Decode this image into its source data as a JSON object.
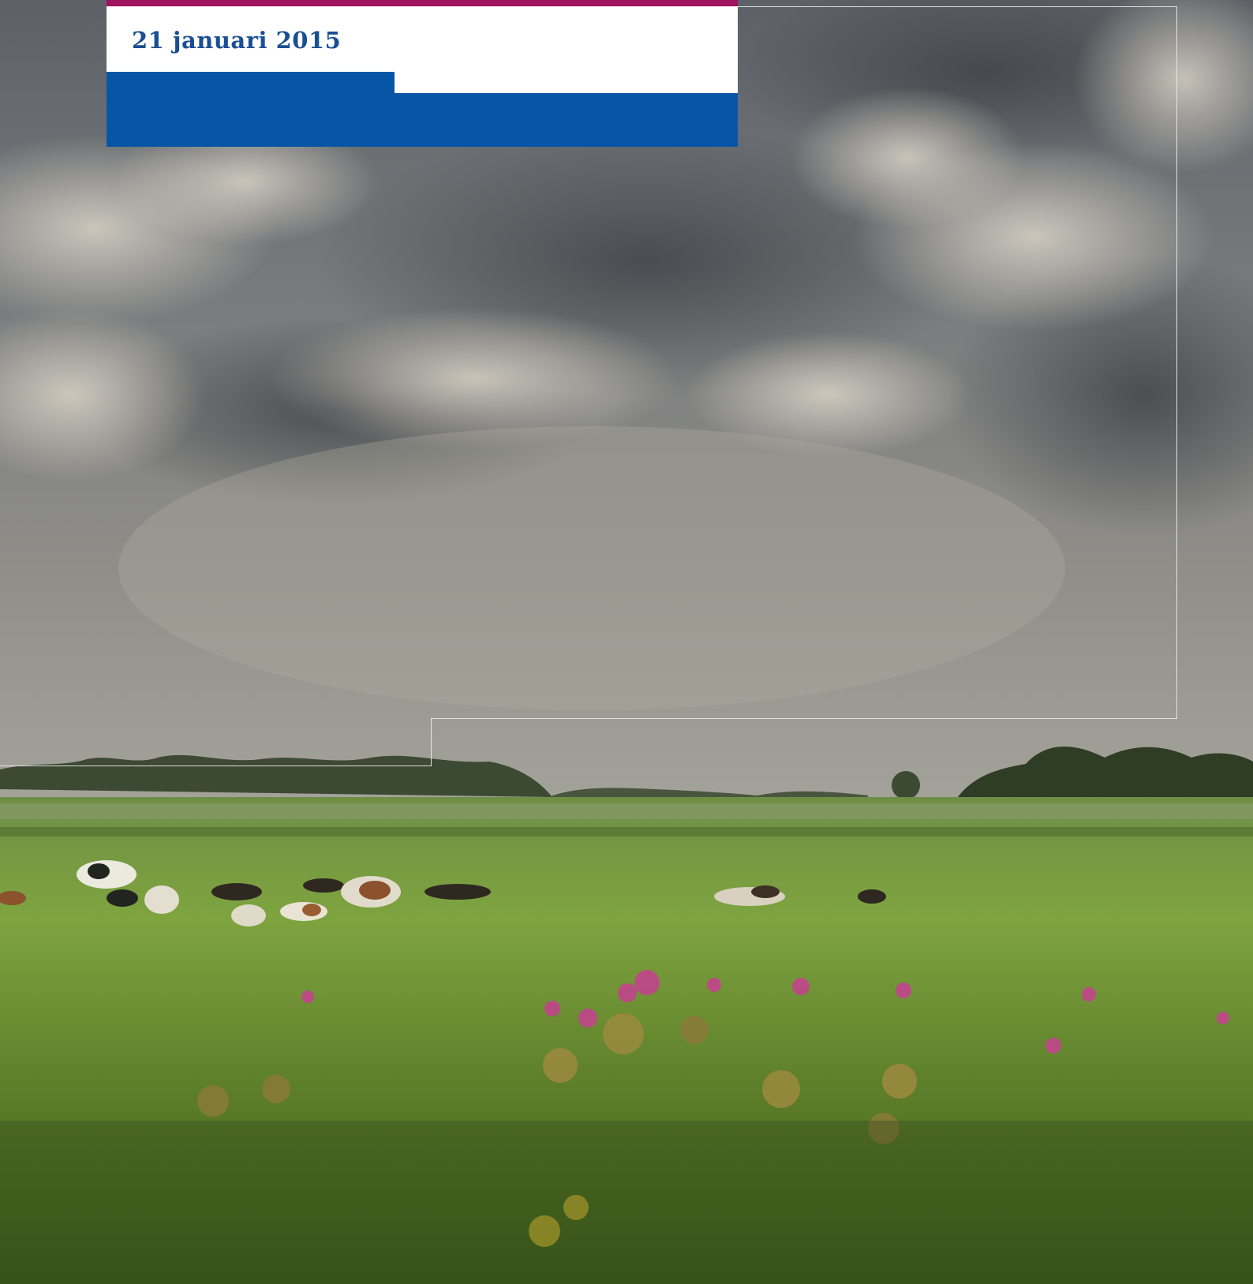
{
  "cover": {
    "date": "21 januari 2015"
  },
  "colors": {
    "accent_magenta": "#a0135f",
    "brand_blue": "#0756a6",
    "date_text": "#1a4f93",
    "frame_line": "#e9ecef"
  },
  "photo": {
    "subject": "cows-in-meadow-under-cloudy-sky"
  }
}
